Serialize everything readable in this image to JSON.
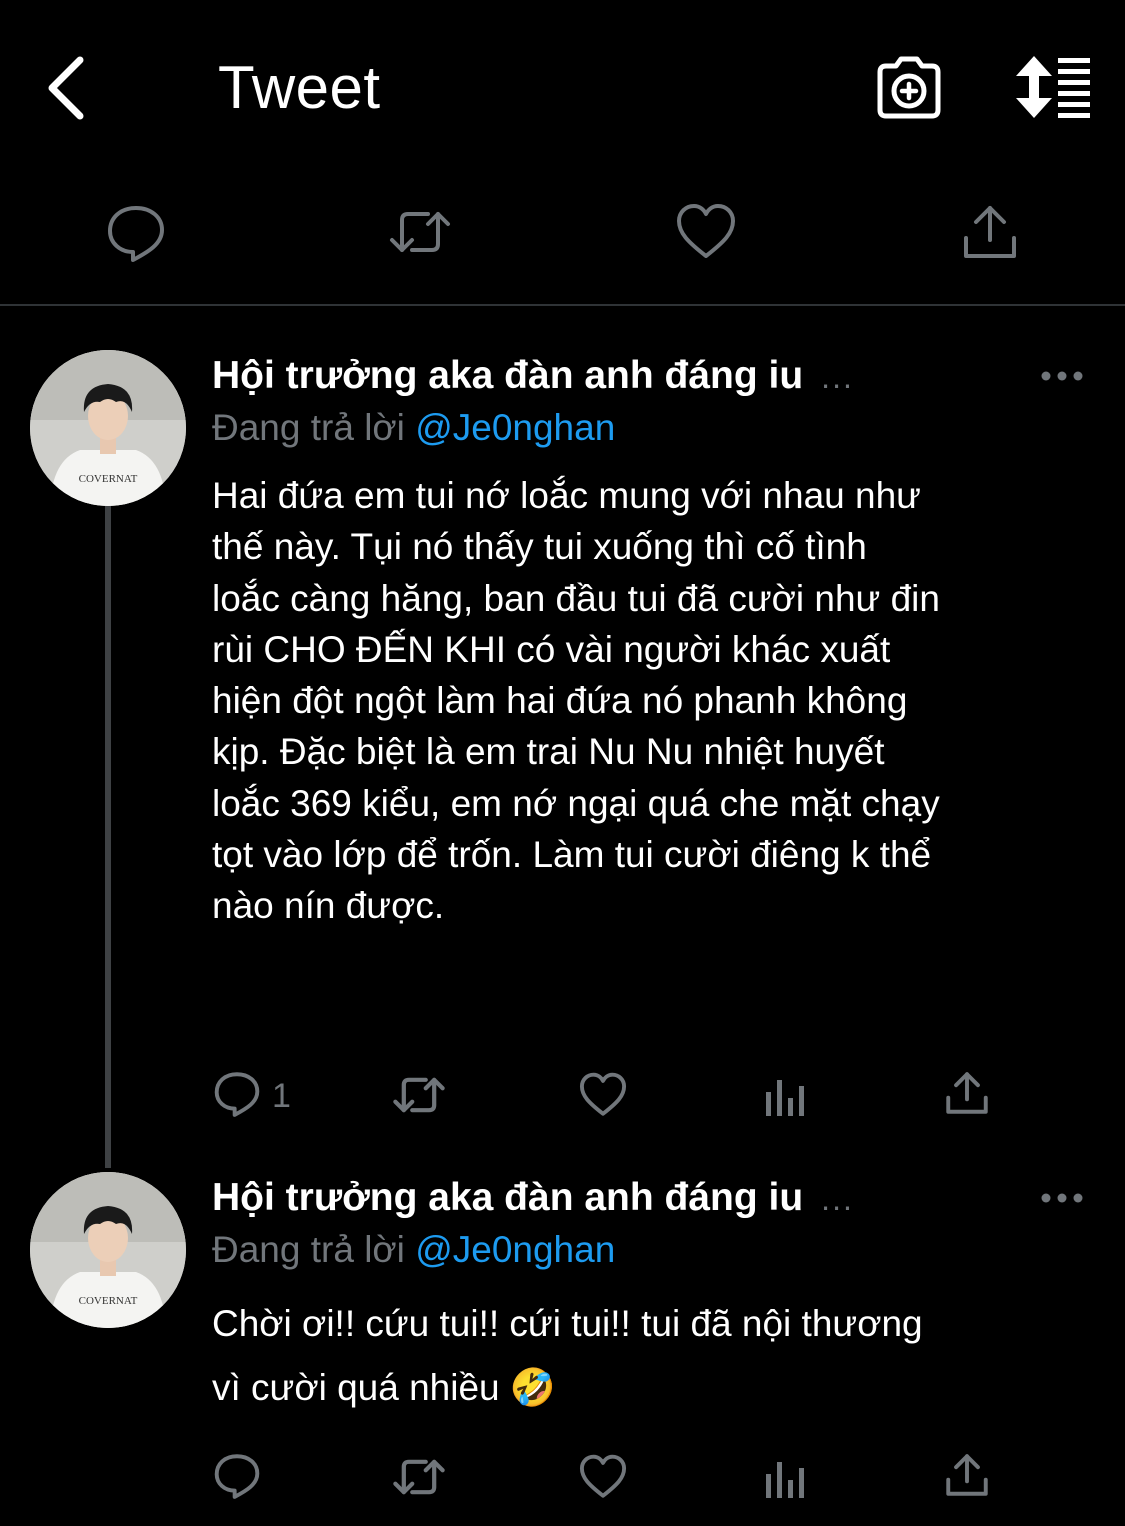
{
  "header": {
    "title": "Tweet",
    "back_icon": "chevron-left-icon",
    "camera_icon": "camera-add-icon",
    "sort_icon": "sort-list-icon"
  },
  "colors": {
    "background": "#000000",
    "text": "#ffffff",
    "muted": "#71767b",
    "link": "#1d9bf0",
    "divider": "#2f3336"
  },
  "replies": [
    {
      "display_name": "Hội trưởng aka đàn anh đáng iu",
      "name_truncation": "...",
      "replying_prefix": "Đang trả lời",
      "replying_handle": "@Je0nghan",
      "lines": [
        "Hai đứa em tui nớ loắc mung với nhau như",
        "thế này. Tụi nó thấy tui xuống thì cố tình",
        "loắc càng hăng, ban đầu tui đã cười như đin",
        "rùi CHO ĐẾN KHI có vài người khác xuất",
        "hiện đột ngột làm hai đứa nó phanh không",
        "kịp. Đặc biệt là em trai Nu Nu nhiệt huyết",
        "loắc 369 kiểu, em nớ ngại quá che mặt chạy",
        "tọt vào lớp để trốn. Làm tui cười điêng k thể",
        "nào nín được."
      ],
      "reply_count": "1"
    },
    {
      "display_name": "Hội trưởng aka đàn anh đáng iu",
      "name_truncation": "...",
      "replying_prefix": "Đang trả lời",
      "replying_handle": "@Je0nghan",
      "lines": [
        "Chời ơi!! cứu tui!! cứi tui!! tui đã nội thương",
        "vì cười quá nhiều 🤣"
      ],
      "reply_count": ""
    }
  ]
}
